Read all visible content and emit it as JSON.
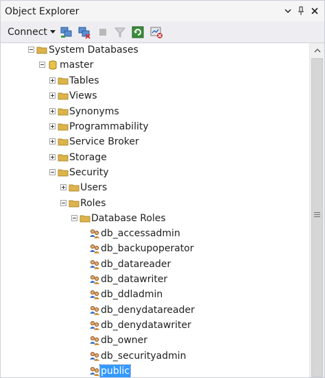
{
  "window": {
    "title": "Object Explorer"
  },
  "titlebar_icons": [
    "chevron-down-icon",
    "pin-icon",
    "close-icon"
  ],
  "toolbar": {
    "connect_label": "Connect",
    "tools": [
      "connect-object-explorer-icon",
      "disconnect-icon",
      "stop-icon",
      "filter-icon",
      "refresh-icon",
      "activity-monitor-icon"
    ]
  },
  "tree": {
    "system_databases": "System Databases",
    "master": "master",
    "tables": "Tables",
    "views": "Views",
    "synonyms": "Synonyms",
    "programmability": "Programmability",
    "service_broker": "Service Broker",
    "storage": "Storage",
    "security": "Security",
    "users": "Users",
    "roles": "Roles",
    "database_roles": "Database Roles",
    "roles_list": [
      "db_accessadmin",
      "db_backupoperator",
      "db_datareader",
      "db_datawriter",
      "db_ddladmin",
      "db_denydatareader",
      "db_denydatawriter",
      "db_owner",
      "db_securityadmin",
      "public"
    ],
    "selected": "public"
  },
  "colors": {
    "selection": "#3399ff",
    "folder": "#dcb44b",
    "toolbar_bg": "#eeeef2"
  }
}
